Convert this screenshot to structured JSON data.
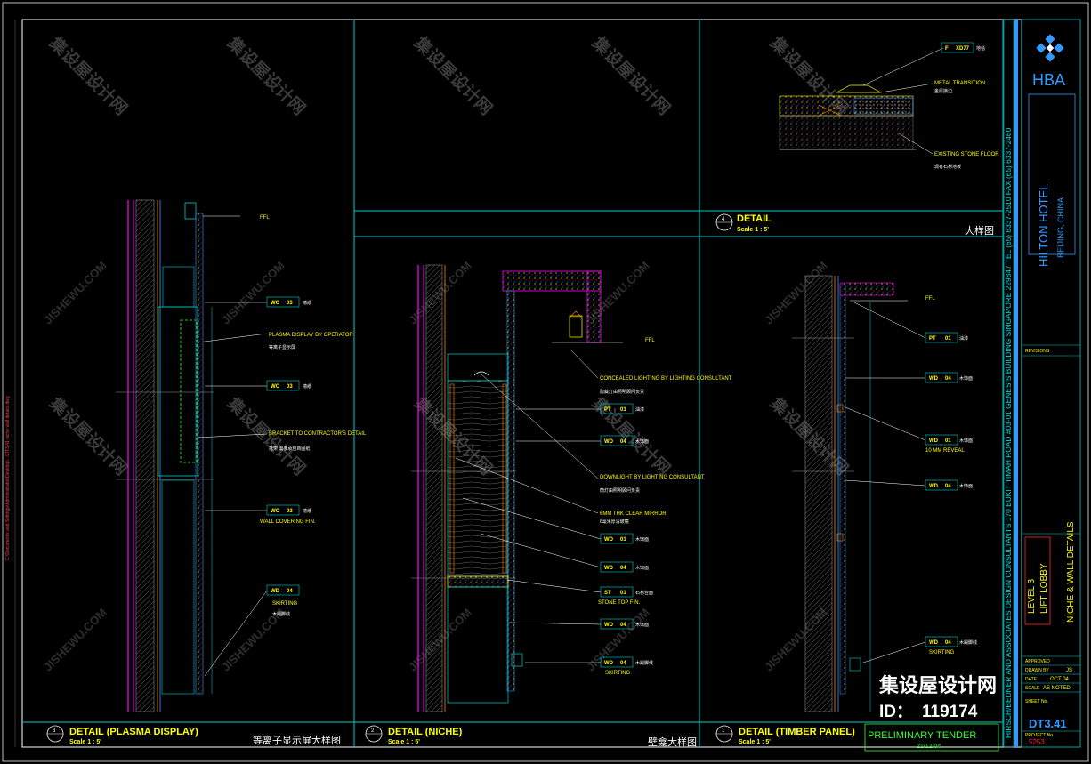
{
  "colors": {
    "background": "#000000",
    "grid": "#00cccc",
    "text": "#ffff00",
    "wall": "#ff00ff",
    "accent": "#33ff33",
    "blue": "#3399ff",
    "red": "#ff2a2a"
  },
  "details": [
    {
      "number": "3",
      "title": "DETAIL (PLASMA DISPLAY)",
      "scale": "Scale 1 : 5'",
      "cn_label": "等离子显示屏大样图"
    },
    {
      "number": "2",
      "title": "DETAIL (NICHE)",
      "scale": "Scale 1 : 5'",
      "cn_label": "壁龛大样图"
    },
    {
      "number": "1",
      "title": "DETAIL (TIMBER PANEL)",
      "scale": "Scale 1 : 5'"
    },
    {
      "number": "4",
      "title": "DETAIL",
      "scale": "Scale 1 : 5'",
      "cn_label": "大样图"
    }
  ],
  "plasma_callouts": [
    {
      "code": "WC",
      "num": "03",
      "cn": "墙纸"
    },
    {
      "en": "PLASMA DISPLAY BY OPERATOR",
      "cn": "等离子显示屏"
    },
    {
      "code": "WC",
      "num": "03",
      "cn": "墙纸"
    },
    {
      "en": "BRACKET TO CONTRACTOR'S DETAIL",
      "cn": "托架 需要承包商图纸"
    },
    {
      "code": "WC",
      "num": "03",
      "cn": "墙纸",
      "en": "WALL COVERING FIN."
    },
    {
      "code": "WD",
      "num": "04",
      "cn": "木踢脚线",
      "en": "SKIRTING"
    }
  ],
  "niche_callouts": [
    {
      "en": "CONCEALED LIGHTING BY LIGHTING CONSULTANT",
      "cn": "隐藏灯由照明顾问负责"
    },
    {
      "code": "PT",
      "num": "01",
      "cn": "油漆"
    },
    {
      "code": "WD",
      "num": "04",
      "cn": "木饰面"
    },
    {
      "en": "DOWNLIGHT BY LIGHTING CONSULTANT",
      "cn": "筒灯由照明顾问负责"
    },
    {
      "en": "6MM THK CLEAR MIRROR",
      "cn": "6毫米厚清玻镜"
    },
    {
      "code": "WD",
      "num": "01",
      "cn": "木饰面"
    },
    {
      "code": "WD",
      "num": "04",
      "cn": "木饰面"
    },
    {
      "code": "ST",
      "num": "01",
      "cn": "石材台面",
      "en": "STONE TOP FIN."
    },
    {
      "code": "WD",
      "num": "04",
      "cn": "木饰面"
    },
    {
      "code": "WD",
      "num": "04",
      "cn": "木踢脚线",
      "en": "SKIRTING"
    }
  ],
  "timber_callouts": [
    {
      "code": "PT",
      "num": "01",
      "cn": "油漆"
    },
    {
      "code": "WD",
      "num": "04",
      "cn": "木饰面"
    },
    {
      "code": "WD",
      "num": "01",
      "cn": "木饰面",
      "en": "10 MM REVEAL"
    },
    {
      "code": "WD",
      "num": "04",
      "cn": "木饰面"
    },
    {
      "code": "WD",
      "num": "04",
      "cn": "木踢脚线",
      "en": "SKIRTING"
    }
  ],
  "detail4_callouts": [
    {
      "code": "F",
      "num": "XD77",
      "cn": "地毯"
    },
    {
      "en": "METAL TRANSITION",
      "cn": "金属接边"
    },
    {
      "en": "EXISTING STONE FLOOR",
      "cn": "现有石材地板"
    }
  ],
  "title_block": {
    "logo": "HBA",
    "project": "HILTON HOTEL",
    "location": "BEIJING, CHINA",
    "revisions": "REVISIONS",
    "level": "LEVEL 3",
    "area": "LIFT LOBBY",
    "drawing": "NICHE & WALL DETAILS",
    "approved": "APPROVED",
    "drawn_by_label": "DRAWN BY",
    "drawn_by": "JS",
    "date_label": "DATE",
    "date": "OCT 04",
    "scale_label": "SCALE",
    "scale": "AS NOTED",
    "sheet_label": "SHEET No.",
    "sheet": "DT3.41",
    "project_no_label": "PROJECT No.",
    "project_no": "5253",
    "firm": "HIRSCH/BEDNER AND ASSOCIATES  DESIGN CONSULTANTS  170 BUKIT TIMAH ROAD #03-01 GENESIS BUILDING  SINGAPORE 229847  TEL (65) 6337-2510  FAX (65) 6337-2460"
  },
  "stamp": {
    "status": "PRELIMINARY TENDER",
    "date": "21/12/04"
  },
  "watermark": {
    "brand": "集设屋设计网",
    "id_label": "ID：",
    "id": "119174",
    "url": "JISHEWU.COM"
  }
}
